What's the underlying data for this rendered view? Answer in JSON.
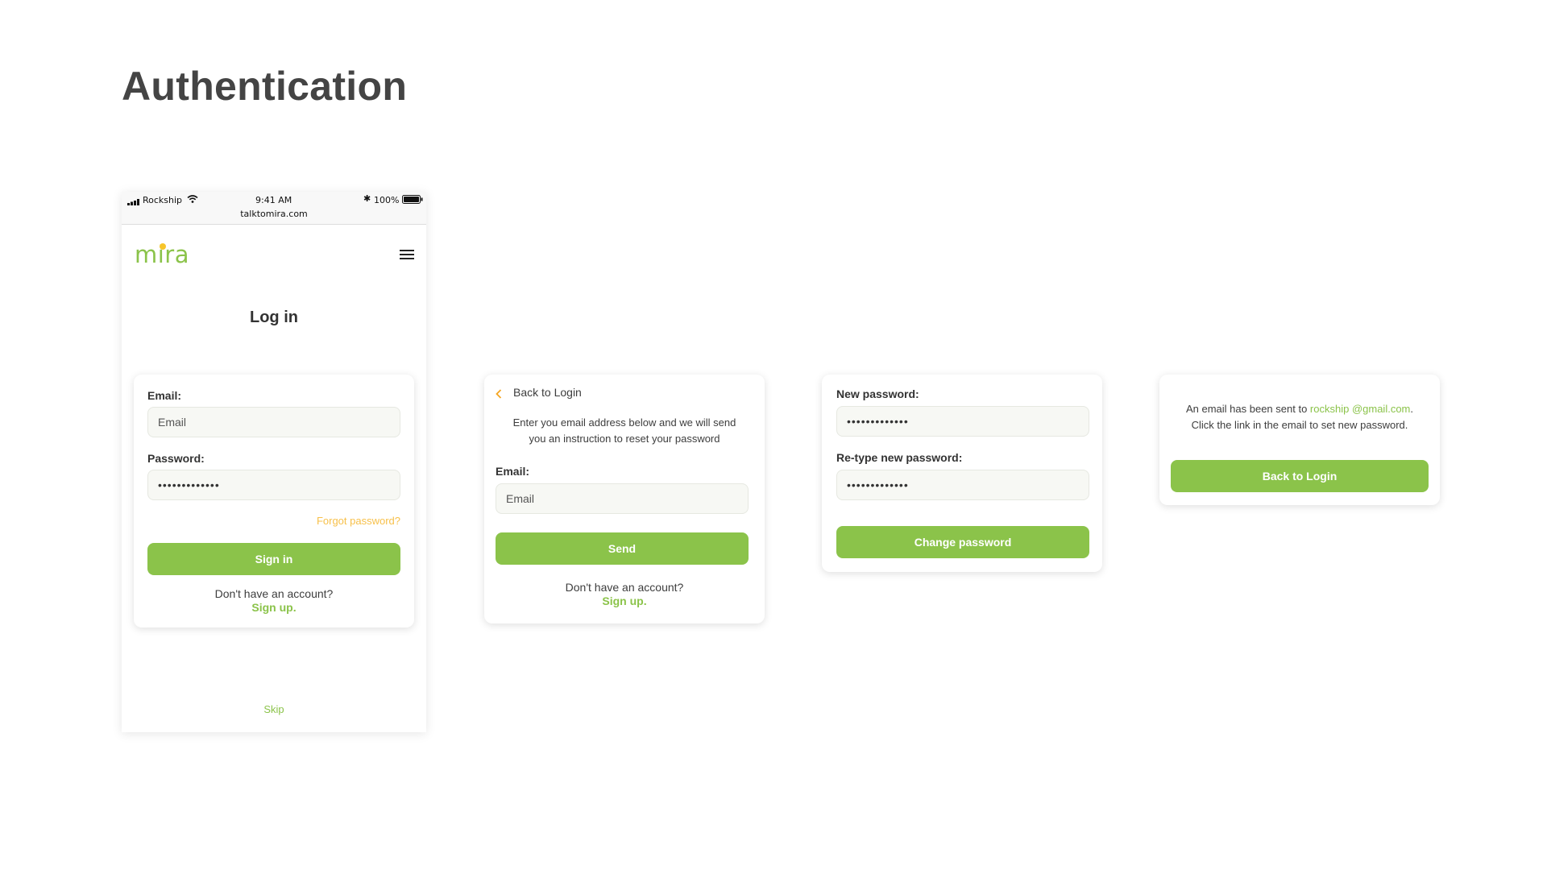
{
  "page": {
    "title": "Authentication"
  },
  "phone": {
    "status": {
      "carrier": "Rockship",
      "time": "9:41 AM",
      "battery": "100%",
      "url": "talktomira.com"
    },
    "logo": "mira",
    "heading": "Log in",
    "login_card": {
      "email_label": "Email:",
      "email_placeholder": "Email",
      "password_label": "Password:",
      "password_value": "•••••••••••••",
      "forgot": "Forgot password?",
      "signin": "Sign in",
      "no_account": "Don't have an account?",
      "signup": "Sign up."
    },
    "skip": "Skip"
  },
  "forgot_card": {
    "back": "Back to Login",
    "instruction_line1": "Enter you email address below and we will send",
    "instruction_line2": "you an instruction to reset your password",
    "email_label": "Email:",
    "email_placeholder": "Email",
    "send": "Send",
    "no_account": "Don't have an account?",
    "signup": "Sign up."
  },
  "reset_card": {
    "new_label": "New password:",
    "new_value": "•••••••••••••",
    "retype_label": "Re-type new password:",
    "retype_value": "•••••••••••••",
    "change": "Change password"
  },
  "sent_card": {
    "line1_prefix": "An email has been sent to ",
    "email": "rockship @gmail.com",
    "line1_suffix": ".",
    "line2": "Click the link in the email to set new password.",
    "back": "Back to Login"
  },
  "colors": {
    "accent": "#8bc34a",
    "forgot_link": "#f7c04a",
    "back_chevron": "#f5a623",
    "logo_dot": "#f7c52b"
  }
}
